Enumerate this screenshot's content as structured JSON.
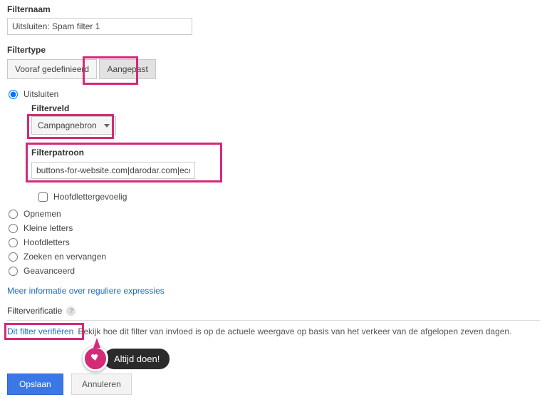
{
  "filterName": {
    "label": "Filternaam",
    "value": "Uitsluiten: Spam filter 1"
  },
  "filterType": {
    "label": "Filtertype",
    "predefined": "Vooraf gedefinieerd",
    "custom": "Aangepast"
  },
  "exclude": {
    "label": "Uitsluiten",
    "filterField": {
      "label": "Filterveld",
      "selected": "Campagnebron"
    },
    "filterPattern": {
      "label": "Filterpatroon",
      "value": "buttons-for-website.com|darodar.com|econom"
    },
    "caseSensitive": "Hoofdlettergevoelig"
  },
  "otherOptions": {
    "include": "Opnemen",
    "lowercase": "Kleine letters",
    "uppercase": "Hoofdletters",
    "searchReplace": "Zoeken en vervangen",
    "advanced": "Geavanceerd"
  },
  "regexInfoLink": "Meer informatie over reguliere expressies",
  "verification": {
    "header": "Filterverificatie",
    "helpGlyph": "?",
    "link": "Dit filter verifiëren",
    "desc": "Bekijk hoe dit filter van invloed is op de actuele weergave op basis van het verkeer van de afgelopen zeven dagen."
  },
  "callout": "Altijd doen!",
  "actions": {
    "save": "Opslaan",
    "cancel": "Annuleren"
  }
}
